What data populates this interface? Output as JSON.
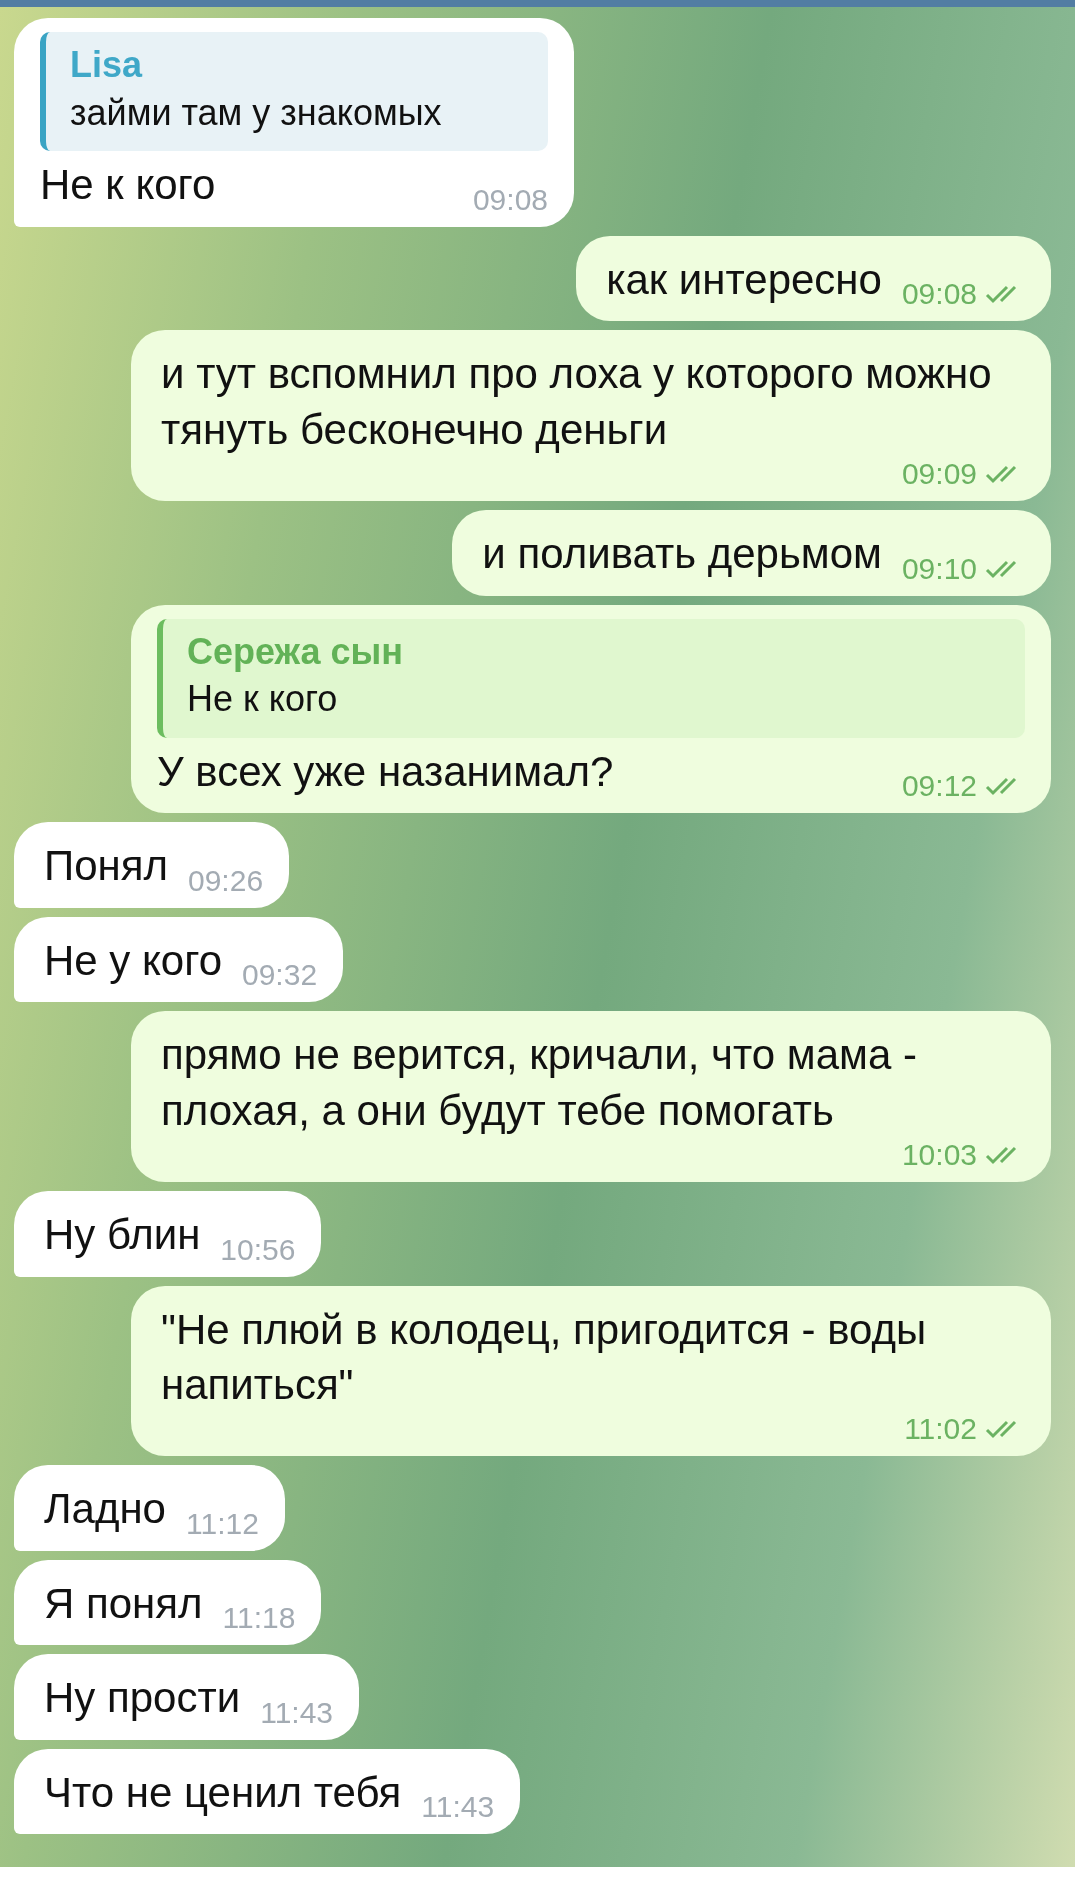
{
  "messages": [
    {
      "kind": "incoming",
      "reply": {
        "author": "Lisa",
        "text": "займи там у знакомых"
      },
      "text": "Не к кого",
      "time": "09:08"
    },
    {
      "kind": "outgoing",
      "text": "как интересно",
      "time": "09:08",
      "read": true
    },
    {
      "kind": "outgoing",
      "text": "и тут вспомнил про лоха у которого можно тянуть бесконечно деньги",
      "time": "09:09",
      "read": true
    },
    {
      "kind": "outgoing",
      "text": "и поливать дерьмом",
      "time": "09:10",
      "read": true
    },
    {
      "kind": "outgoing",
      "reply": {
        "author": "Сережа сын",
        "text": "Не к кого"
      },
      "text": "У всех уже назанимал?",
      "time": "09:12",
      "read": true
    },
    {
      "kind": "incoming",
      "text": "Понял",
      "time": "09:26"
    },
    {
      "kind": "incoming",
      "text": "Не у кого",
      "time": "09:32"
    },
    {
      "kind": "outgoing",
      "text": "прямо не верится, кричали, что мама - плохая, а они будут тебе  помогать",
      "time": "10:03",
      "read": true
    },
    {
      "kind": "incoming",
      "text": "Ну блин",
      "time": "10:56"
    },
    {
      "kind": "outgoing",
      "text": "\"Не плюй в колодец, пригодится - воды напиться\"",
      "time": "11:02",
      "read": true
    },
    {
      "kind": "incoming",
      "text": "Ладно",
      "time": "11:12"
    },
    {
      "kind": "incoming",
      "text": "Я понял",
      "time": "11:18"
    },
    {
      "kind": "incoming",
      "text": "Ну прости",
      "time": "11:43"
    },
    {
      "kind": "incoming",
      "text": "Что не ценил тебя",
      "time": "11:43"
    }
  ]
}
